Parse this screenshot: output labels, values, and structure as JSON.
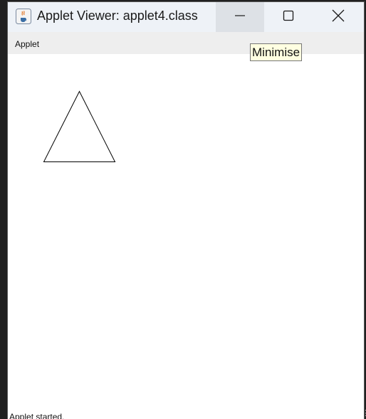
{
  "window": {
    "title": "Applet Viewer: applet4.class",
    "icon": "java-cup-icon",
    "controls": {
      "minimize_icon": "minimize-icon",
      "maximize_icon": "maximize-icon",
      "close_icon": "close-icon"
    }
  },
  "menu": {
    "items": [
      "Applet"
    ]
  },
  "canvas": {
    "shape": "triangle",
    "stroke_color": "#000000"
  },
  "status": {
    "text": "Applet started."
  },
  "tooltip": {
    "text": "Minimise"
  }
}
